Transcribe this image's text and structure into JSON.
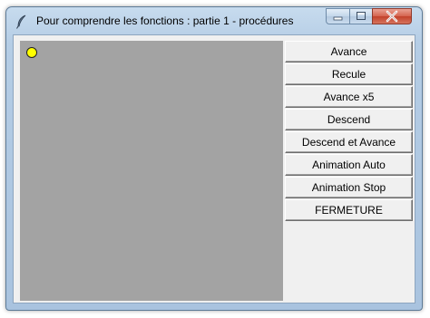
{
  "window": {
    "title": "Pour comprendre les fonctions : partie 1 - procédures"
  },
  "icons": {
    "app": "feather-icon",
    "minimize": "minimize-icon",
    "maximize": "maximize-icon",
    "close": "close-icon"
  },
  "colors": {
    "canvas": "#a3a3a3",
    "ball": "#ffff00",
    "close_button": "#c9503a"
  },
  "buttons": [
    {
      "label": "Avance"
    },
    {
      "label": "Recule"
    },
    {
      "label": "Avance x5"
    },
    {
      "label": "Descend"
    },
    {
      "label": "Descend et Avance"
    },
    {
      "label": "Animation Auto"
    },
    {
      "label": "Animation Stop"
    },
    {
      "label": "FERMETURE"
    }
  ]
}
